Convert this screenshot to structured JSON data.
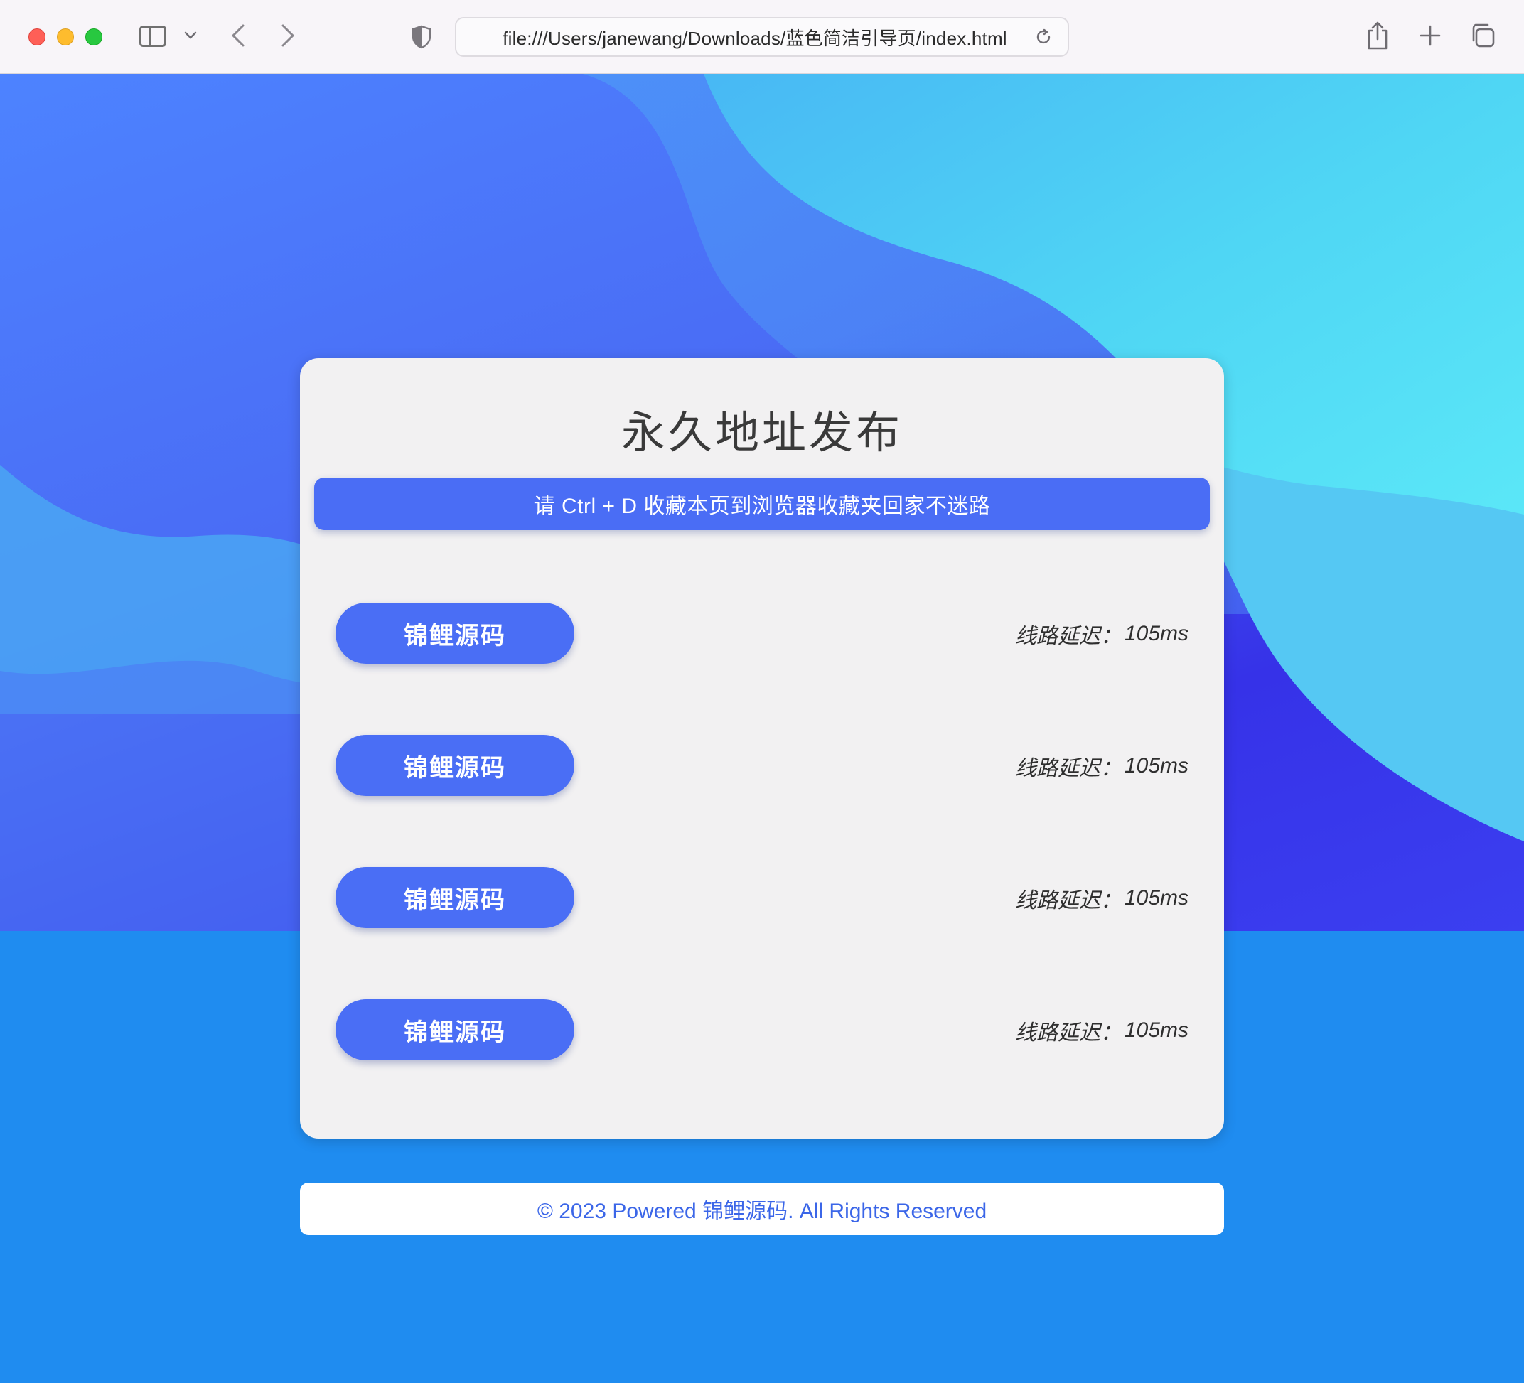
{
  "browser": {
    "url": "file:///Users/janewang/Downloads/蓝色简洁引导页/index.html"
  },
  "page": {
    "title": "永久地址发布",
    "notice": "请 Ctrl + D 收藏本页到浏览器收藏夹回家不迷路",
    "links": [
      {
        "label": "锦鲤源码",
        "latency_label": "线路延迟：",
        "latency_value": "105ms"
      },
      {
        "label": "锦鲤源码",
        "latency_label": "线路延迟：",
        "latency_value": "105ms"
      },
      {
        "label": "锦鲤源码",
        "latency_label": "线路延迟：",
        "latency_value": "105ms"
      },
      {
        "label": "锦鲤源码",
        "latency_label": "线路延迟：",
        "latency_value": "105ms"
      }
    ],
    "footer": "© 2023 Powered 锦鲤源码. All Rights Reserved"
  },
  "colors": {
    "accent": "#4a6ef5",
    "footer_text": "#3b66e8",
    "card_bg": "#f2f1f2"
  }
}
